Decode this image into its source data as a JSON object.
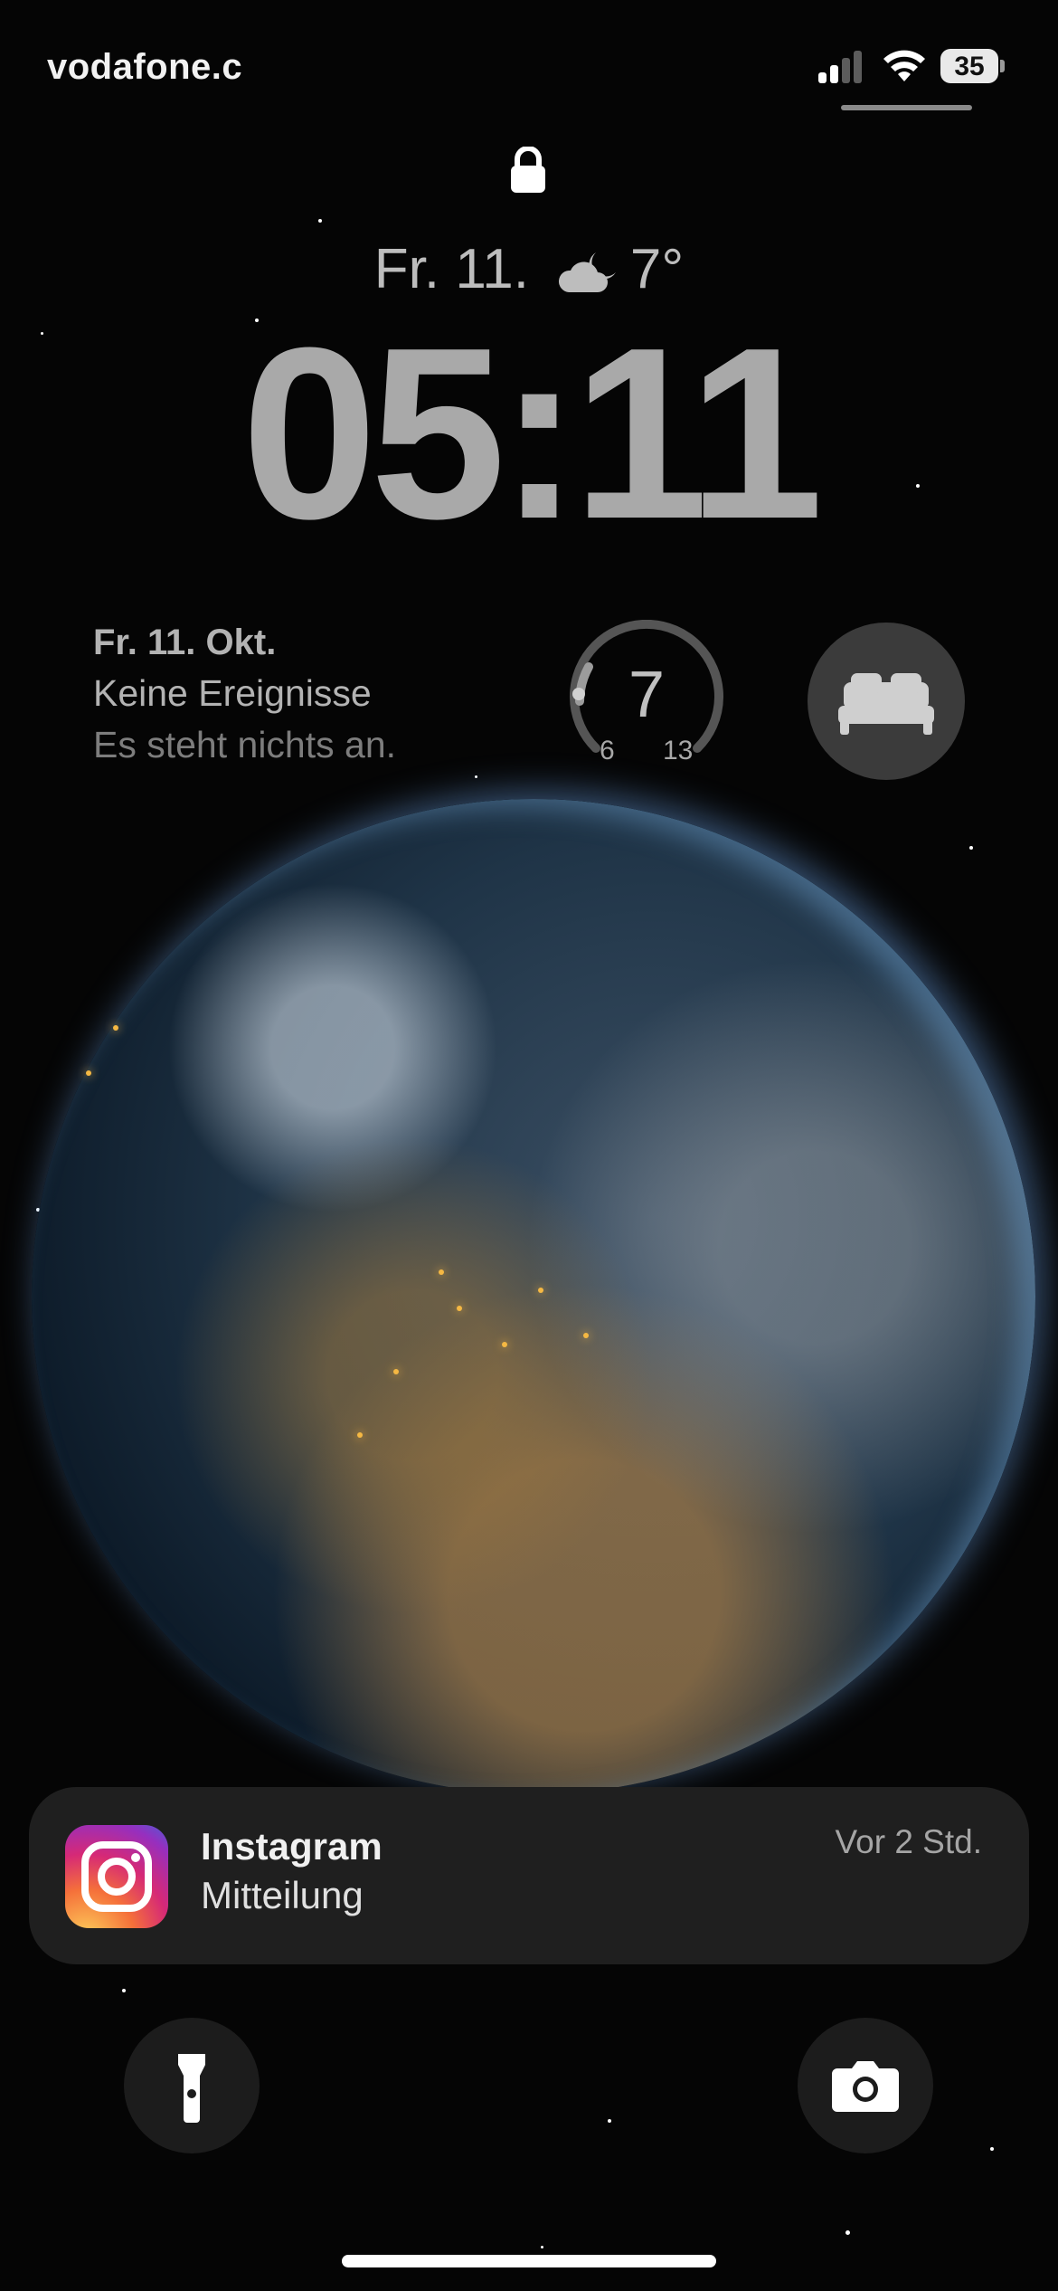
{
  "status_bar": {
    "carrier": "vodafone.c",
    "battery_level": "35",
    "signal_bars_active": 2,
    "signal_bars_total": 4
  },
  "lock_screen": {
    "date_short": "Fr. 11.",
    "weather_icon": "cloud-moon-icon",
    "temperature": "7°",
    "time": "05:11"
  },
  "widgets": {
    "calendar": {
      "date": "Fr. 11. Okt.",
      "events": "Keine Ereignisse",
      "subtitle": "Es steht nichts an."
    },
    "temperature_gauge": {
      "current": "7",
      "low": "6",
      "high": "13"
    },
    "sleep": {
      "icon": "bed-icon"
    }
  },
  "notification": {
    "app": "Instagram",
    "message": "Mitteilung",
    "time": "Vor 2 Std.",
    "icon": "instagram-icon"
  },
  "quick_actions": {
    "left_icon": "flashlight-icon",
    "right_icon": "camera-icon"
  },
  "colors": {
    "background": "#050505",
    "notification_bg": "#1f1f1f",
    "widget_bg": "#3b3b3b"
  }
}
